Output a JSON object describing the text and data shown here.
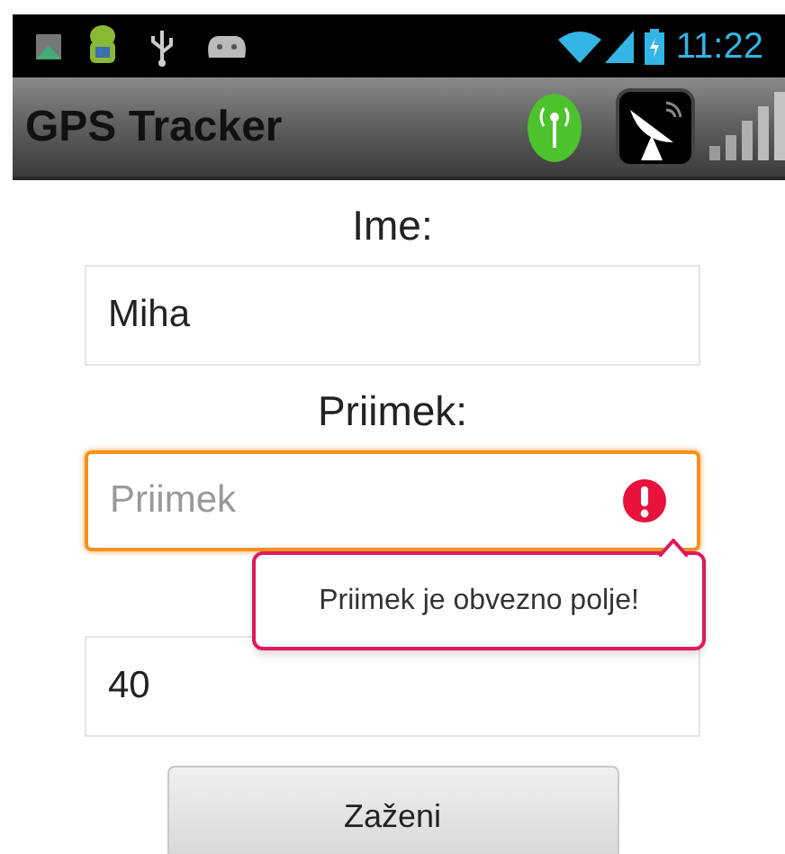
{
  "status_bar": {
    "time": "11:22"
  },
  "action_bar": {
    "title": "GPS Tracker"
  },
  "form": {
    "fields": [
      {
        "label": "Ime:",
        "value": "Miha",
        "error": false
      },
      {
        "label": "Priimek:",
        "placeholder": "Priimek",
        "error": true,
        "error_message": "Priimek je obvezno polje!"
      },
      {
        "value": "40",
        "error": false
      }
    ],
    "button": "Zaženi"
  }
}
